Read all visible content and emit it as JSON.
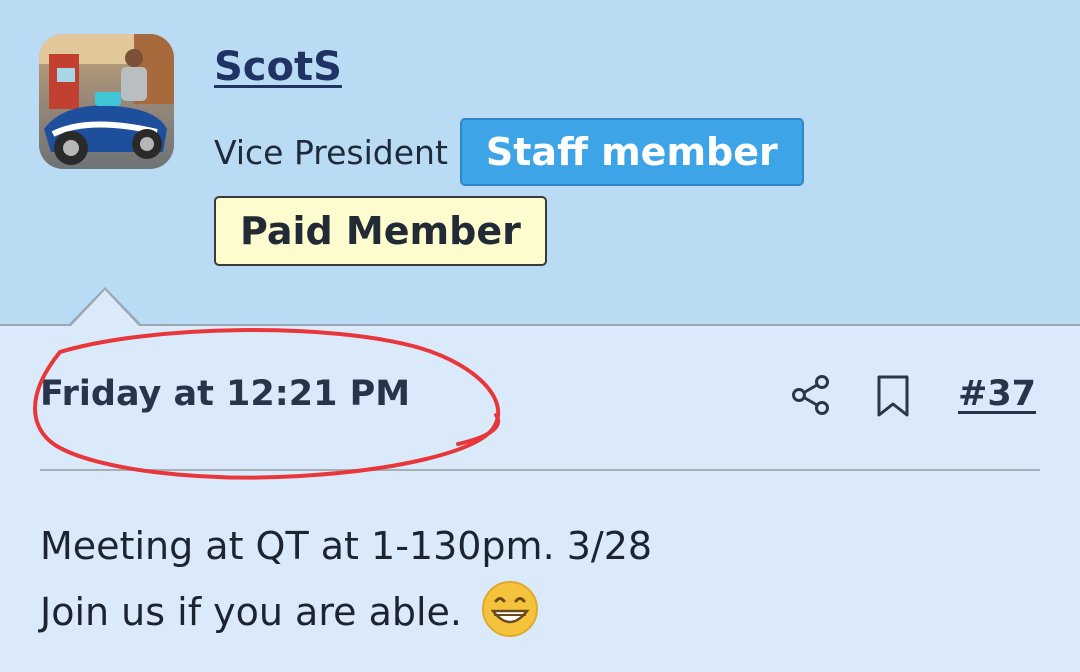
{
  "user": {
    "username": "ScotS",
    "title": "Vice President",
    "badges": {
      "staff": "Staff member",
      "paid": "Paid Member"
    }
  },
  "post": {
    "date": "Friday at 12:21 PM",
    "number": "#37",
    "body_lines": [
      "Meeting at QT at 1-130pm. 3/28",
      "Join us if you are able."
    ],
    "emoji": "grinning-face-emoji"
  },
  "icons": {
    "share": "share-icon",
    "bookmark": "bookmark-icon"
  },
  "colors": {
    "header_bg": "#b9dcf4",
    "body_bg": "#daeafb",
    "username": "#1f3464",
    "staff_badge": "#3ea4e8",
    "paid_badge": "#fdfccf",
    "annotation": "#e8373a"
  }
}
